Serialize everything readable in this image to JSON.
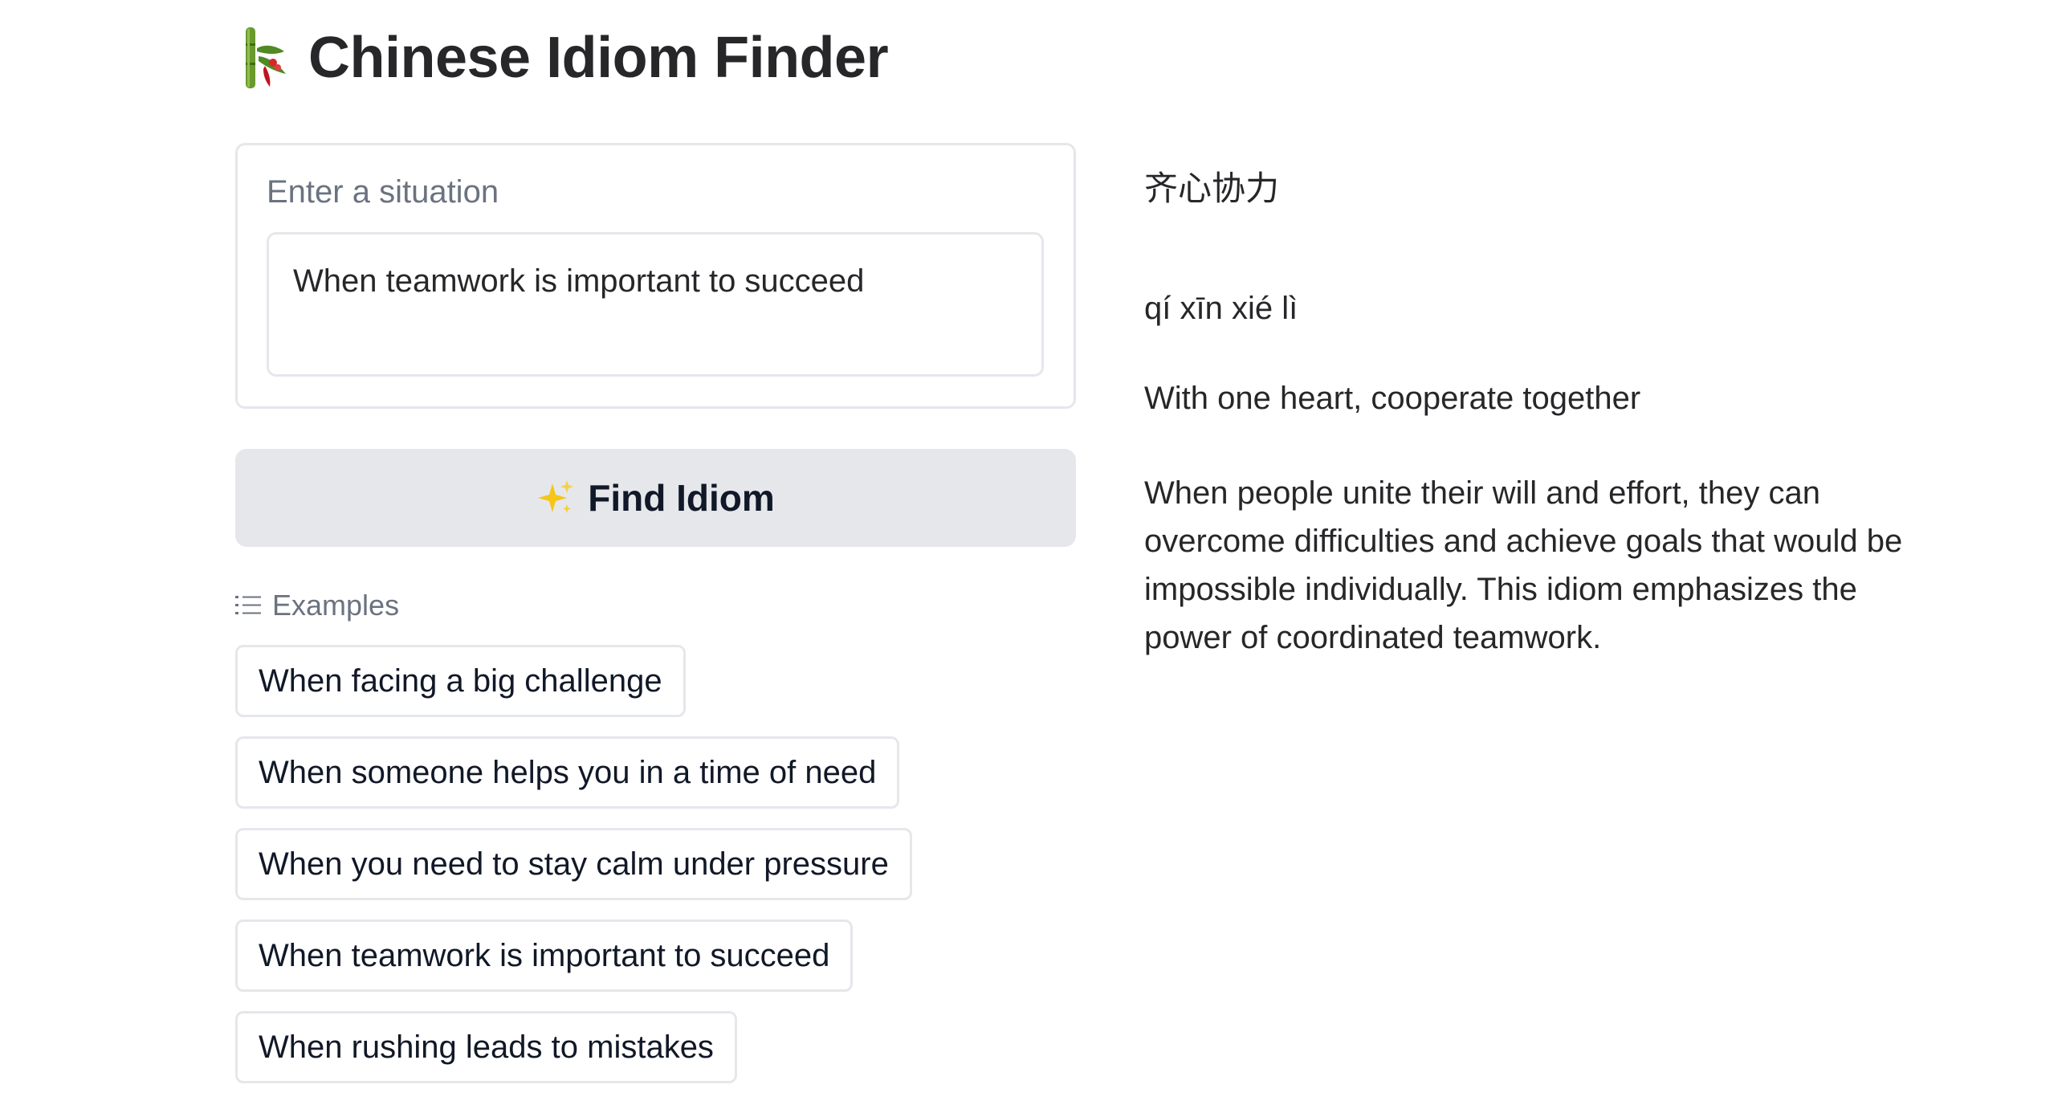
{
  "app": {
    "title": "Chinese Idiom Finder",
    "logo_icon": "bamboo-icon"
  },
  "input": {
    "label": "Enter a situation",
    "value": "When teamwork is important to succeed"
  },
  "find_button": {
    "icon": "sparkles-icon",
    "label": "Find Idiom"
  },
  "examples": {
    "icon": "list-icon",
    "label": "Examples",
    "items": [
      "When facing a big challenge",
      "When someone helps you in a time of need",
      "When you need to stay calm under pressure",
      "When teamwork is important to succeed",
      "When rushing leads to mistakes"
    ]
  },
  "result": {
    "idiom": "齐心协力",
    "pinyin": "qí xīn xié lì",
    "translation": "With one heart, cooperate together",
    "explanation": "When people unite their will and effort, they can overcome difficulties and achieve goals that would be impossible individually. This idiom emphasizes the power of coordinated teamwork."
  },
  "colors": {
    "button_bg": "#e5e7eb",
    "border": "#e5e7eb",
    "label_gray": "#6b7280",
    "text_dark": "#27272a",
    "bamboo_green": "#5b8c2a",
    "sparkle_yellow": "#f5c518"
  }
}
